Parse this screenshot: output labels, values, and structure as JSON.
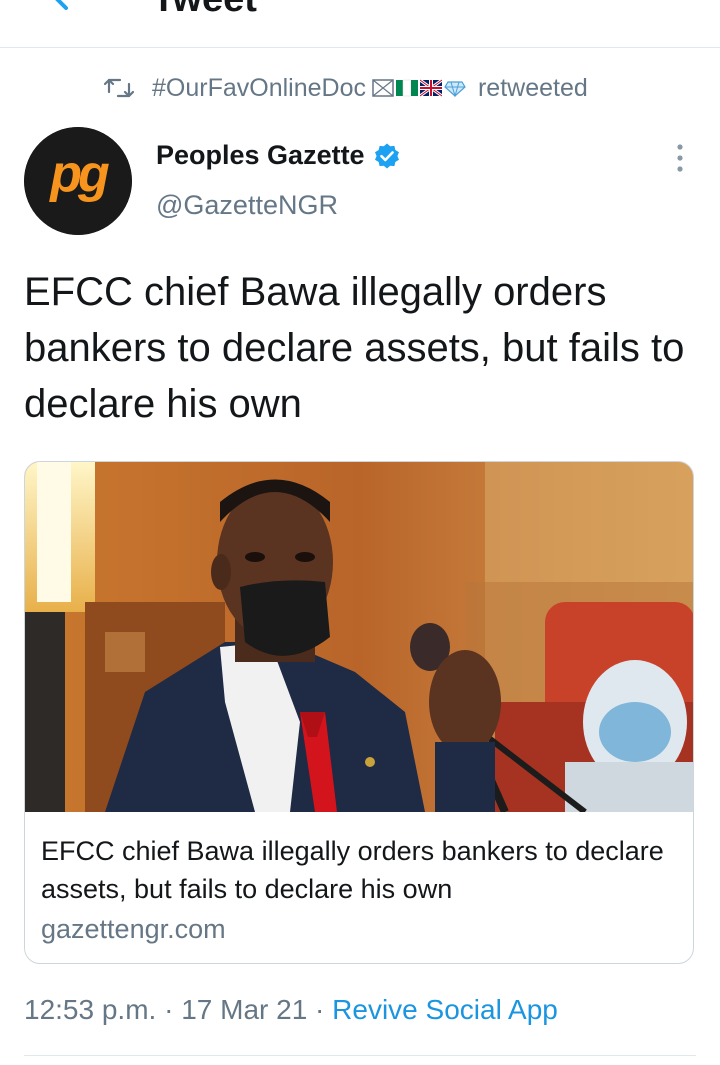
{
  "header": {
    "title": "Tweet",
    "back_icon": "arrow-left-icon"
  },
  "retweet": {
    "icon": "retweet-icon",
    "user": "#OurFavOnlineDoc",
    "suffix": "retweeted",
    "flag_icons": [
      "flag-icon",
      "nigeria-flag-icon",
      "uk-flag-icon",
      "diamond-icon"
    ]
  },
  "author": {
    "avatar_text": "pg",
    "name": "Peoples Gazette",
    "handle": "@GazetteNGR",
    "verified_icon": "verified-badge-icon",
    "more_icon": "more-vertical-icon"
  },
  "tweet": {
    "text": "EFCC chief Bawa illegally orders bankers to declare assets, but fails to declare his own"
  },
  "card": {
    "title": "EFCC chief Bawa illegally orders bankers to declare assets, but fails to declare his own",
    "domain": "gazettengr.com"
  },
  "meta": {
    "time": "12:53 p.m.",
    "separator": " · ",
    "date": "17 Mar 21",
    "source": "Revive Social App"
  },
  "colors": {
    "text_primary": "#14171a",
    "text_secondary": "#657786",
    "link": "#1b95e0",
    "verified": "#1da1f2",
    "brand_orange": "#f7941d"
  }
}
